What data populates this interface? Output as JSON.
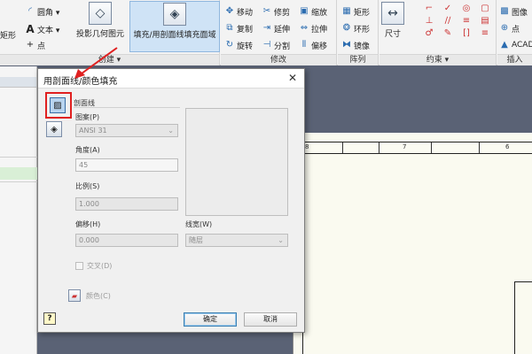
{
  "ribbon": {
    "groups": [
      {
        "label": "创建 ▾"
      },
      {
        "label": "修改"
      },
      {
        "label": "阵列"
      },
      {
        "label": "约束 ▾"
      },
      {
        "label": "插入"
      }
    ],
    "create": {
      "rect": "矩形",
      "fillet": "圆角 ▾",
      "text": "文本 ▾",
      "point": "点",
      "project": "投影几何图元",
      "fill": "填充/用剖面线填充面域"
    },
    "modify": {
      "move": "移动",
      "trim": "修剪",
      "scale": "缩放",
      "copy": "复制",
      "extend": "延伸",
      "stretch": "拉伸",
      "rotate": "旋转",
      "split": "分割",
      "offset": "偏移"
    },
    "array": {
      "rect": "矩形",
      "circ": "环形",
      "mirror": "镜像"
    },
    "constraint": {
      "dim": "尺寸"
    },
    "insert": {
      "image": "图像",
      "point": "点",
      "acad": "ACAD"
    }
  },
  "dialog": {
    "title": "用剖面线/颜色填充",
    "section": "剖面线",
    "pattern_label": "图案(P)",
    "pattern_value": "ANSI 31",
    "angle_label": "角度(A)",
    "angle_value": "45",
    "scale_label": "比例(S)",
    "scale_value": "1.000",
    "offset_label": "偏移(H)",
    "offset_value": "0.000",
    "linewidth_label": "线宽(W)",
    "linewidth_value": "随层",
    "cross_label": "交叉(D)",
    "color_label": "颜色(C)",
    "ok": "确定",
    "cancel": "取消",
    "help": "?",
    "close": "✕"
  },
  "ruler": {
    "marks": [
      "8",
      "7",
      "6"
    ]
  }
}
